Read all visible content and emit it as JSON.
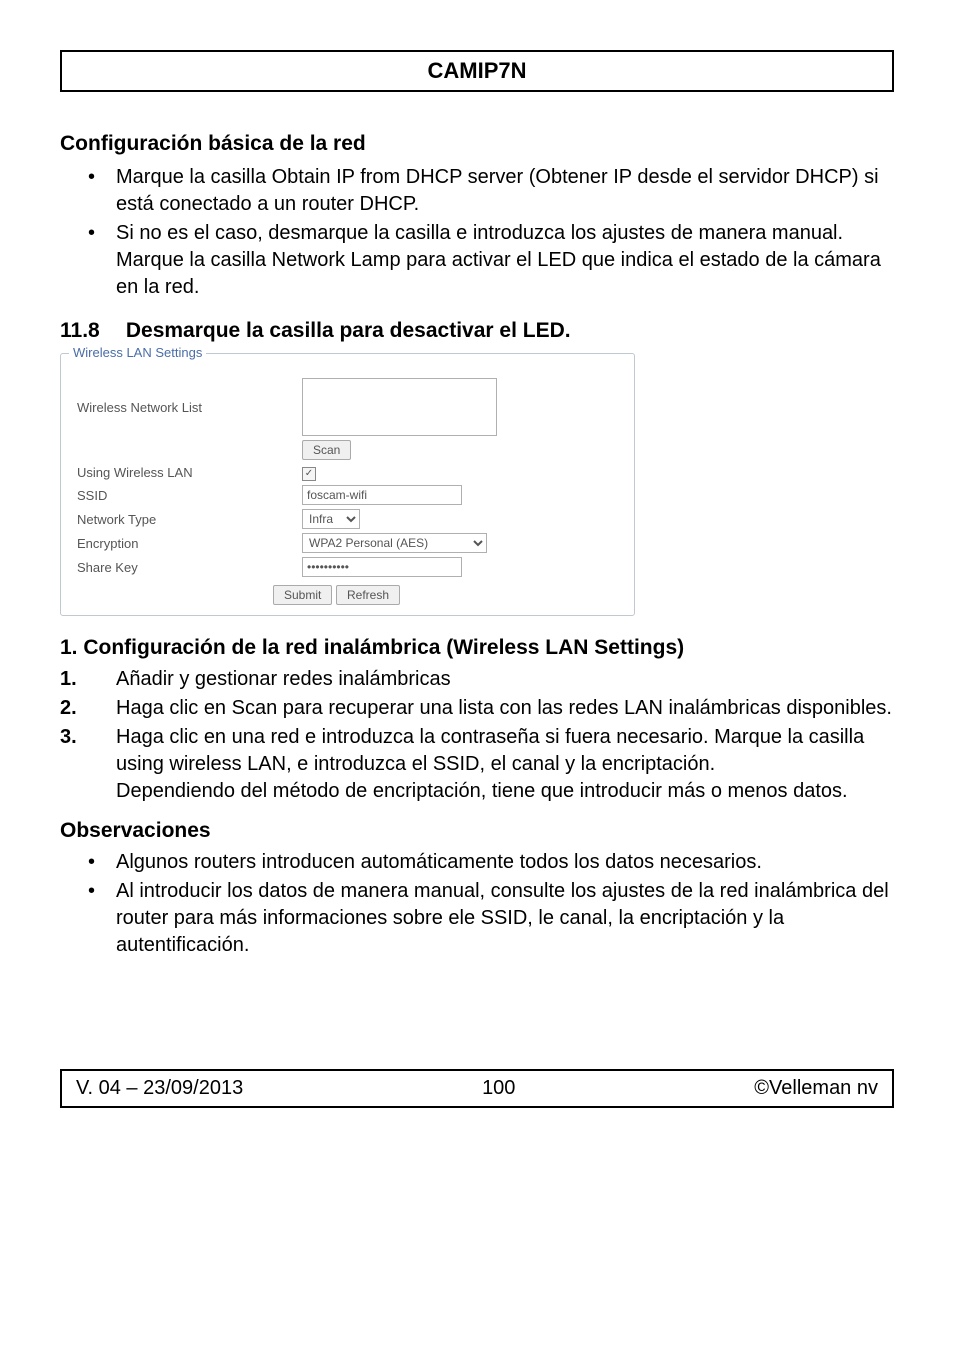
{
  "header": {
    "title": "CAMIP7N"
  },
  "section1": {
    "heading": "Configuración básica de la red",
    "bullets": [
      "Marque la casilla Obtain IP from DHCP server (Obtener IP desde el servidor DHCP) si está conectado a un router DHCP.",
      "Si no es el caso, desmarque la casilla e introduzca los ajustes de manera manual. Marque la casilla Network Lamp para activar el LED que indica el estado de la cámara en la red."
    ]
  },
  "section2": {
    "number": "11.8",
    "heading": "Desmarque la casilla para desactivar el LED."
  },
  "wlan": {
    "legend": "Wireless LAN Settings",
    "rows": {
      "network_list_label": "Wireless Network List",
      "scan_button": "Scan",
      "using_label": "Using Wireless LAN",
      "using_checked": "✓",
      "ssid_label": "SSID",
      "ssid_value": "foscam-wifi",
      "nettype_label": "Network Type",
      "nettype_value": "Infra",
      "encryption_label": "Encryption",
      "encryption_value": "WPA2 Personal (AES)",
      "sharekey_label": "Share Key",
      "sharekey_value": "••••••••••",
      "submit_button": "Submit",
      "refresh_button": "Refresh"
    }
  },
  "section3": {
    "heading": "1. Configuración de la red inalámbrica (Wireless LAN Settings)",
    "items": [
      {
        "num": "1.",
        "text": "Añadir y gestionar redes inalámbricas"
      },
      {
        "num": "2.",
        "text": "Haga clic en Scan para recuperar una lista con las redes LAN inalámbricas disponibles."
      },
      {
        "num": "3.",
        "text": "Haga clic en una red e introduzca la contraseña si fuera necesario. Marque la casilla using wireless LAN, e introduzca el SSID, el canal y la encriptación.\nDependiendo del método de encriptación, tiene que introducir más o menos datos."
      }
    ]
  },
  "section4": {
    "heading": "Observaciones",
    "bullets": [
      "Algunos routers introducen automáticamente todos los datos necesarios.",
      "Al introducir los datos de manera manual, consulte los ajustes de la red inalámbrica del router para más informaciones sobre ele SSID, le canal, la encriptación y la autentificación."
    ]
  },
  "footer": {
    "left": "V. 04 – 23/09/2013",
    "center": "100",
    "right": "©Velleman nv"
  }
}
